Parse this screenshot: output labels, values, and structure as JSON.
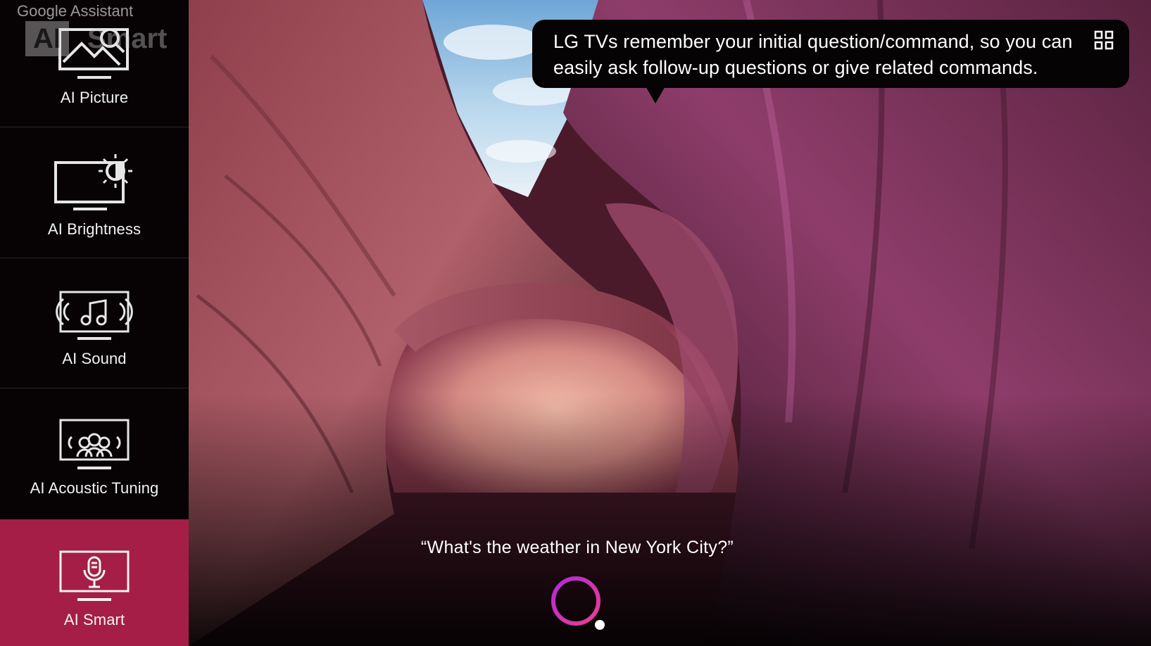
{
  "assistant_header": "Google Assistant",
  "ghost_heading": {
    "box_text": "AI",
    "text": "Smart"
  },
  "sidebar": {
    "items": [
      {
        "label": "AI Picture",
        "icon": "ai-picture-icon",
        "active": false
      },
      {
        "label": "AI Brightness",
        "icon": "ai-brightness-icon",
        "active": false
      },
      {
        "label": "AI Sound",
        "icon": "ai-sound-icon",
        "active": false
      },
      {
        "label": "AI Acoustic Tuning",
        "icon": "ai-acoustic-tuning-icon",
        "active": false
      },
      {
        "label": "AI Smart",
        "icon": "ai-smart-microphone-icon",
        "active": true
      }
    ]
  },
  "tip_bubble": {
    "text": "LG TVs remember your initial question/command, so you can\neasily ask follow-up questions or give related commands.",
    "icon": "apps-grid-icon"
  },
  "voice_query": "“What's the weather in New York City?”",
  "colors": {
    "active_item": "#a51e48",
    "assistant_gradient": [
      "#b02ad8",
      "#e83f8f"
    ]
  }
}
